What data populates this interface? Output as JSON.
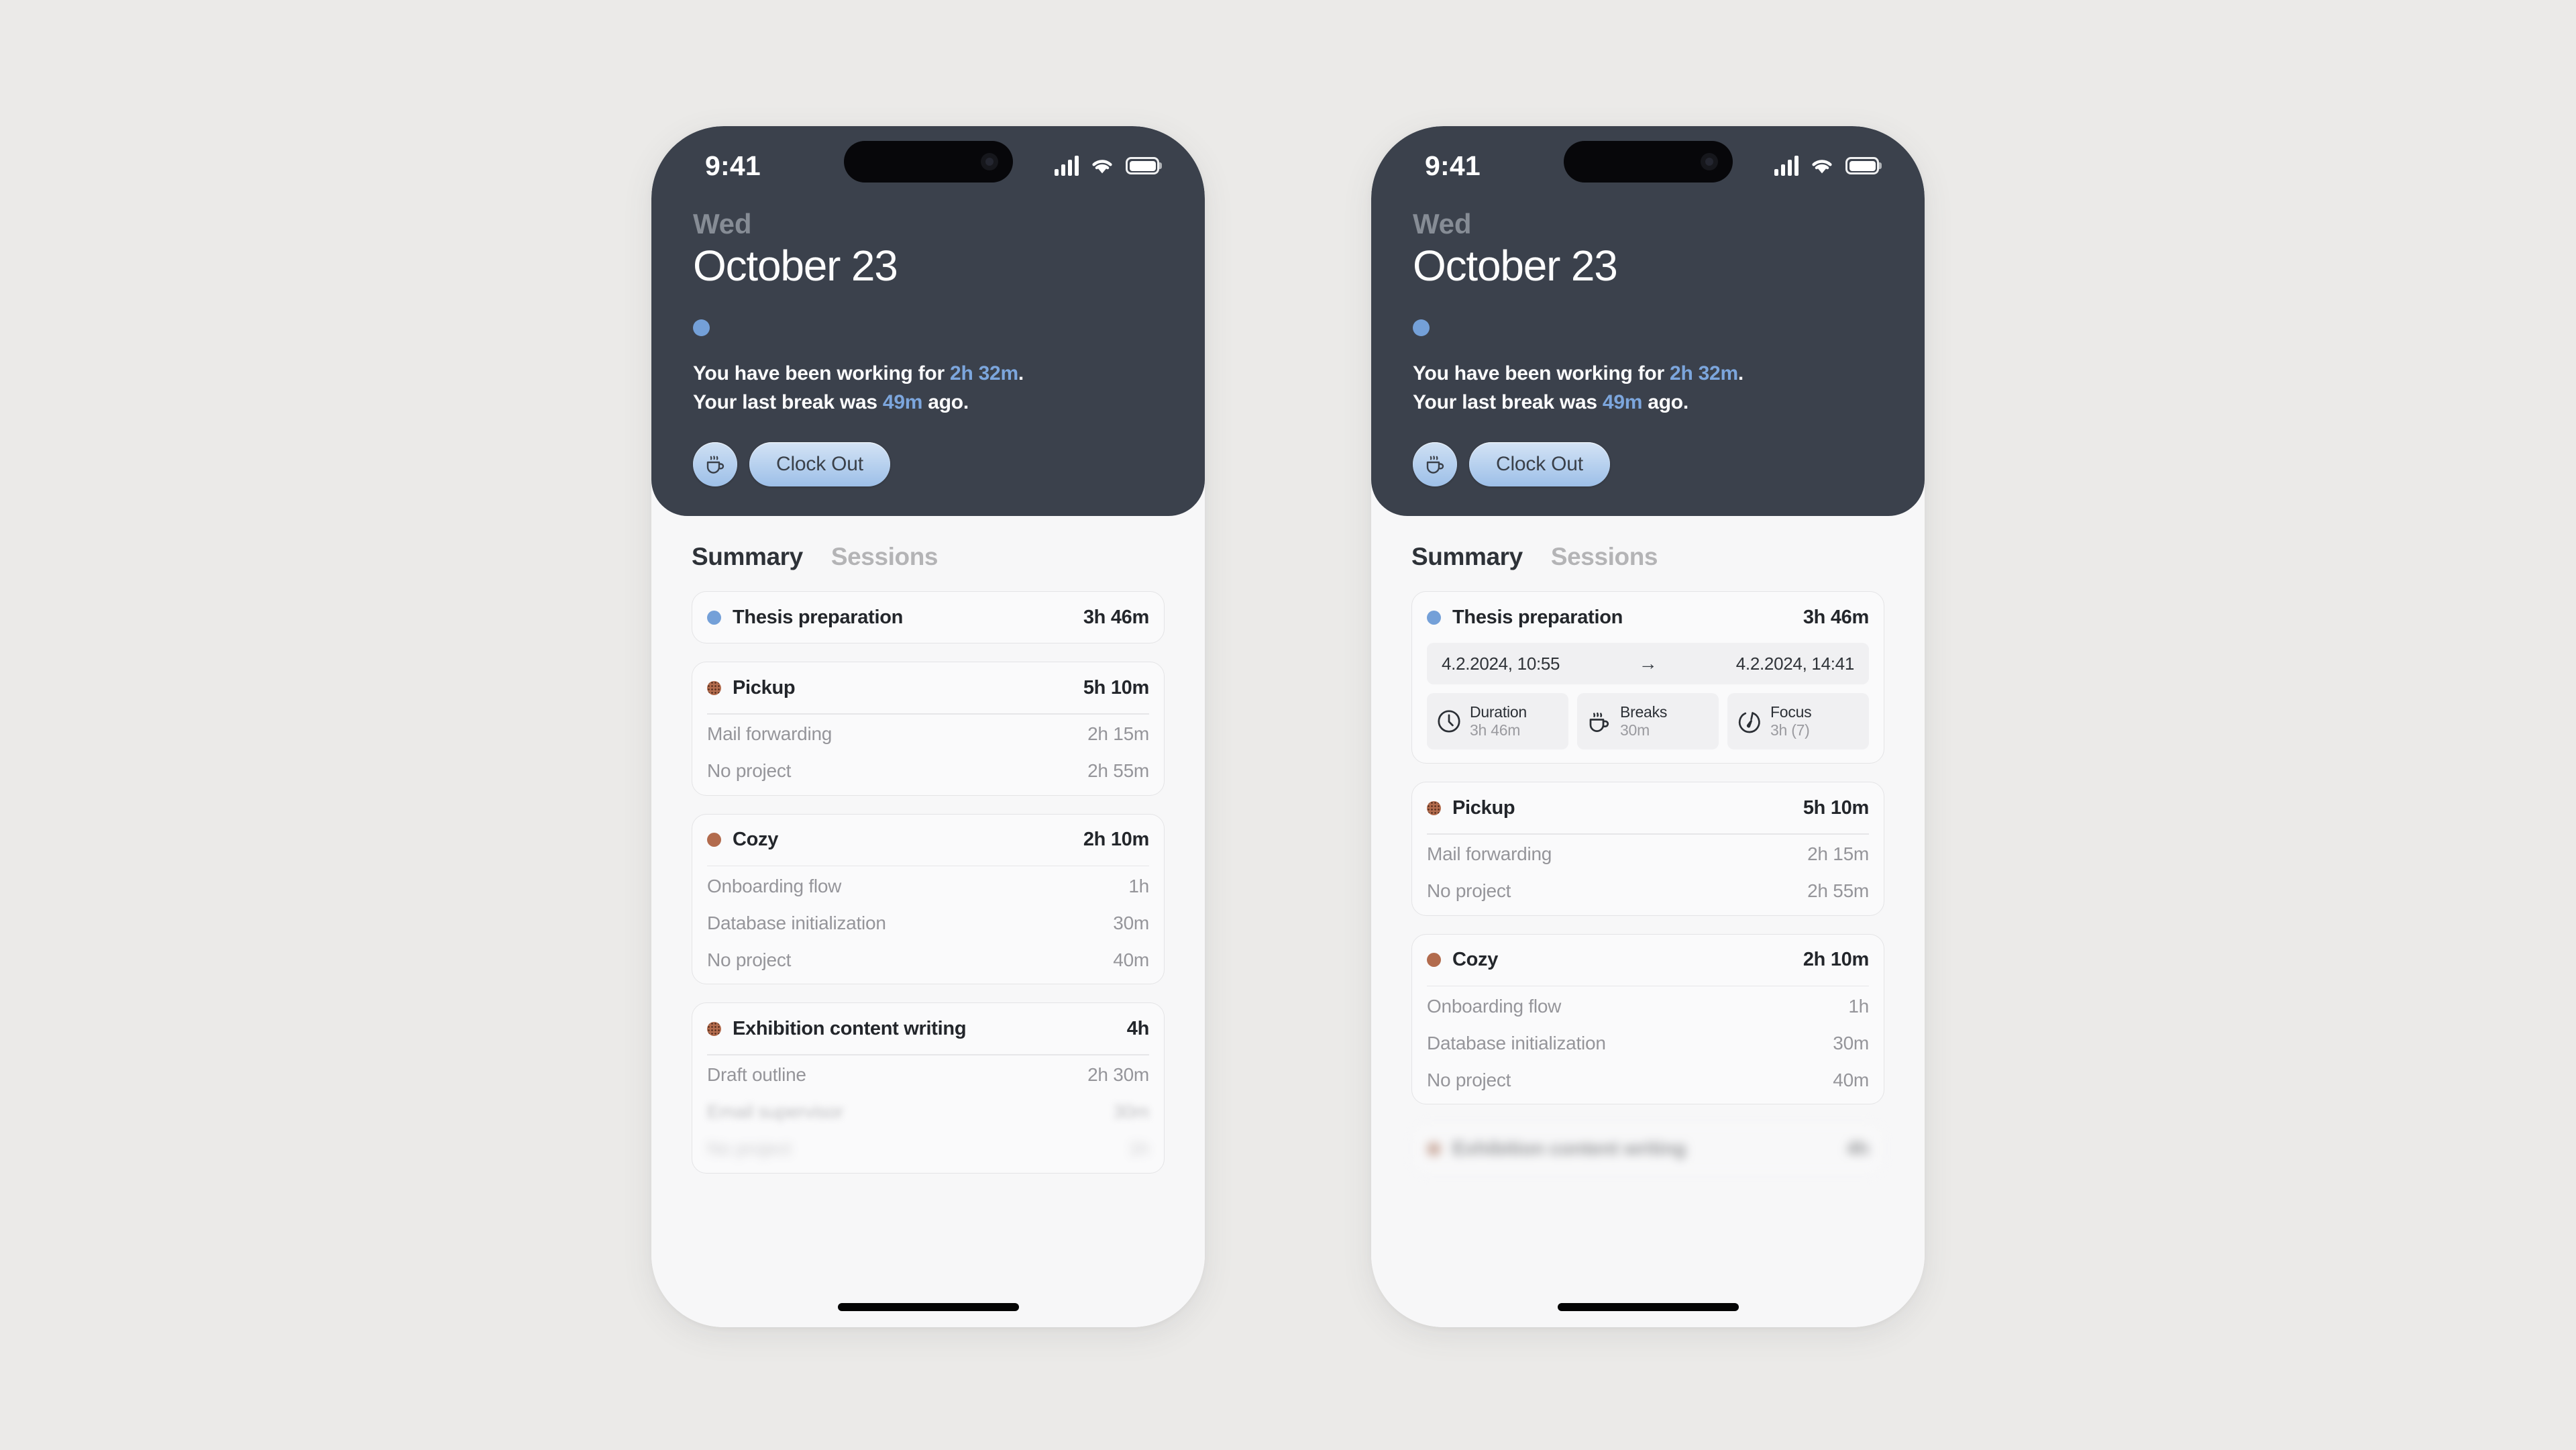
{
  "background_color": "#ebeae8",
  "accent_color": "#74a0d8",
  "header_color": "#3b414c",
  "status_bar": {
    "time": "9:41",
    "cellular_icon": "signal-bars-icon",
    "wifi_icon": "wifi-icon",
    "battery_icon": "battery-icon"
  },
  "header": {
    "weekday": "Wed",
    "date": "October 23",
    "status_dot_color": "#74a0d8",
    "summary_prefix": "You have been working for ",
    "summary_worked": "2h 32m",
    "summary_middle": ".",
    "summary_break_prefix": "Your last break was ",
    "summary_break_value": "49m",
    "summary_break_suffix": " ago.",
    "break_button_icon": "coffee-cup-icon",
    "clock_out_label": "Clock Out"
  },
  "tabs": [
    {
      "label": "Summary",
      "active": true
    },
    {
      "label": "Sessions",
      "active": false
    }
  ],
  "cards": [
    {
      "name": "Thesis preparation",
      "total": "3h 46m",
      "dot_color": "#74a0d8",
      "dot_style": "solid",
      "items": []
    },
    {
      "name": "Pickup",
      "total": "5h 10m",
      "dot_color": "#b26b4d",
      "dot_style": "dotted",
      "items": [
        {
          "label": "Mail forwarding",
          "value": "2h 15m"
        },
        {
          "label": "No project",
          "value": "2h 55m"
        }
      ]
    },
    {
      "name": "Cozy",
      "total": "2h 10m",
      "dot_color": "#b26b4d",
      "dot_style": "solid",
      "items": [
        {
          "label": "Onboarding flow",
          "value": "1h"
        },
        {
          "label": "Database initialization",
          "value": "30m"
        },
        {
          "label": "No project",
          "value": "40m"
        }
      ]
    },
    {
      "name": "Exhibition content writing",
      "total": "4h",
      "dot_color": "#b26b4d",
      "dot_style": "dotted",
      "items": [
        {
          "label": "Draft outline",
          "value": "2h 30m"
        },
        {
          "label": "Email supervisor",
          "value": "30m"
        },
        {
          "label": "No project",
          "value": "1h"
        }
      ]
    }
  ],
  "expanded_session": {
    "name": "Thesis preparation",
    "total": "3h 46m",
    "dot_color": "#74a0d8",
    "start_time": "4.2.2024, 10:55",
    "arrow": "→",
    "end_time": "4.2.2024, 14:41",
    "stats": [
      {
        "icon": "clock-icon",
        "label": "Duration",
        "value": "3h 46m"
      },
      {
        "icon": "coffee-cup-icon",
        "label": "Breaks",
        "value": "30m"
      },
      {
        "icon": "focus-gauge-icon",
        "label": "Focus",
        "value": "3h (7)"
      }
    ]
  }
}
